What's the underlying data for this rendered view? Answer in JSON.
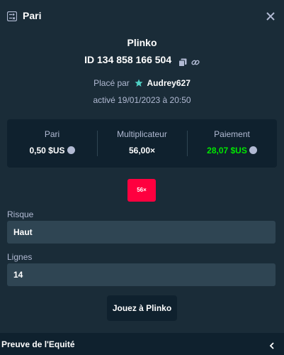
{
  "header": {
    "title": "Pari",
    "icon": "bet-slip-icon",
    "close_icon": "close-icon"
  },
  "bet": {
    "game": "Plinko",
    "id": "ID 134 858 166 504",
    "placed_prefix": "Placé par",
    "user": "Audrey627",
    "activated": "activé 19/01/2023 à 20:50"
  },
  "stats": {
    "bet_label": "Pari",
    "bet_value": "0,50 $US",
    "multiplier_label": "Multiplicateur",
    "multiplier_value": "56,00×",
    "payout_label": "Paiement",
    "payout_value": "28,07 $US"
  },
  "result_badge": "56×",
  "risk": {
    "label": "Risque",
    "value": "Haut"
  },
  "lines": {
    "label": "Lignes",
    "value": "14"
  },
  "play_button": "Jouez à Plinko",
  "footer": {
    "label": "Preuve de l'Equité"
  },
  "colors": {
    "background": "#1a2c38",
    "panel": "#0f212e",
    "input": "#2f4553",
    "muted_text": "#b1bad3",
    "payout_green": "#00e701",
    "badge_red": "#ff003f",
    "star_accent": "#4fd1c5"
  }
}
